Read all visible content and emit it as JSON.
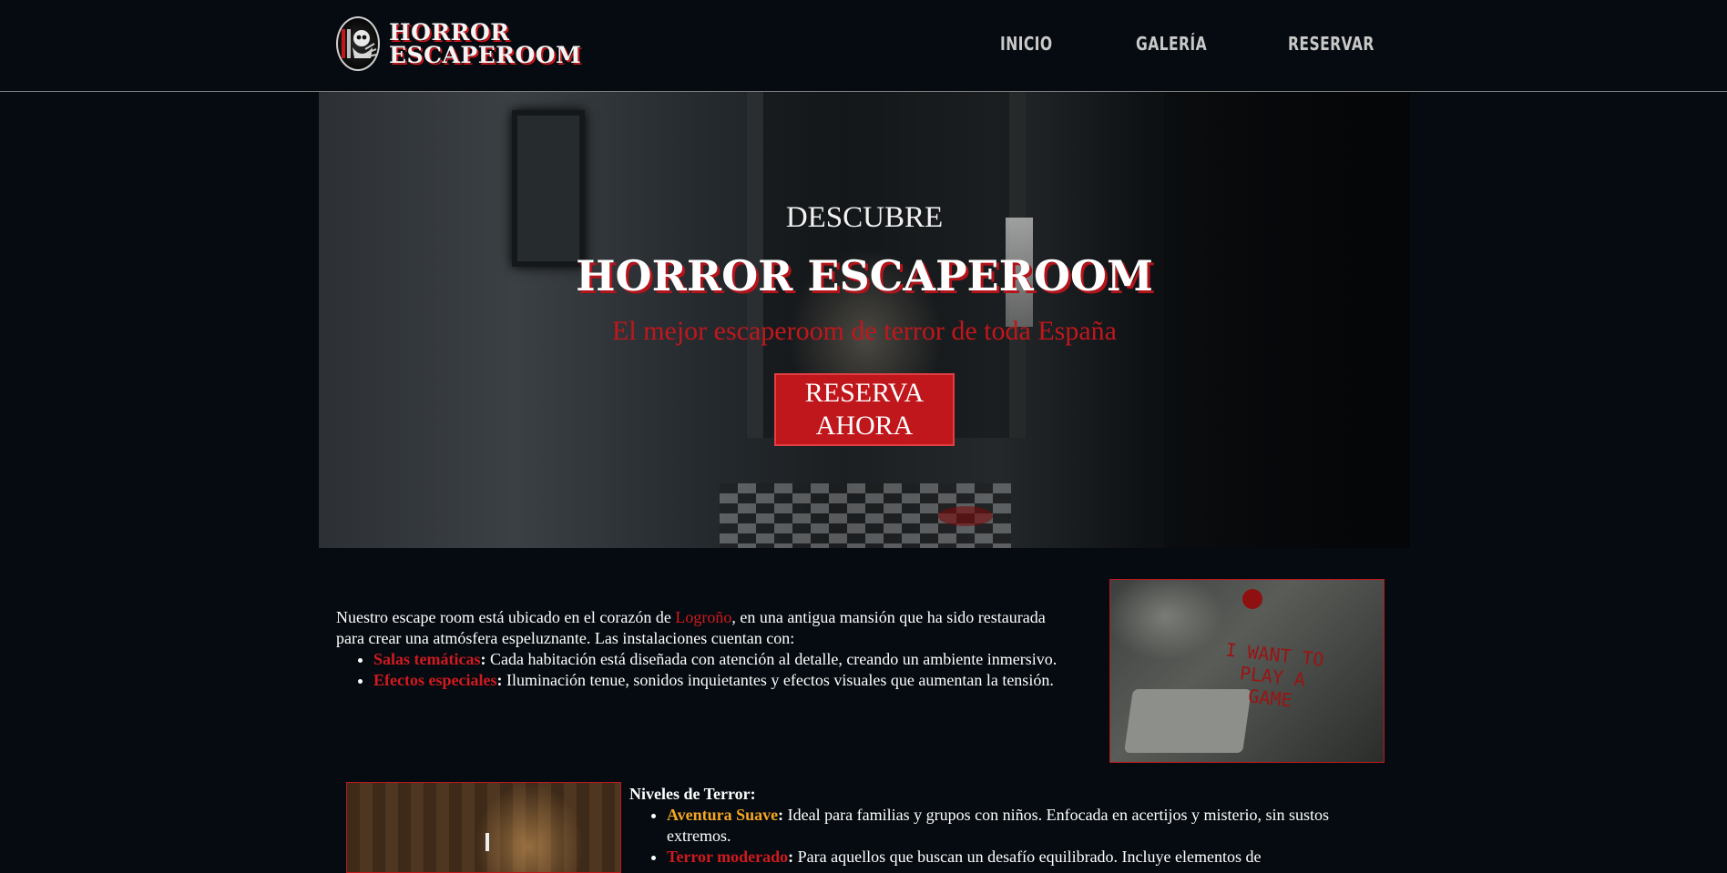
{
  "header": {
    "logo_line1": "HORROR",
    "logo_line2": "ESCAPEROOM",
    "nav": [
      "INICIO",
      "GALERÍA",
      "RESERVAR"
    ]
  },
  "hero": {
    "kicker": "DESCUBRE",
    "title": "HORROR ESCAPEROOM",
    "subtitle": "El mejor escaperoom de terror de toda España",
    "cta": "RESERVA AHORA"
  },
  "intro": {
    "text_before": "Nuestro escape room está ubicado en el corazón de ",
    "city": "Logroño",
    "text_after": ", en una antigua mansión que ha sido restaurada para crear una atmósfera espeluznante. Las instalaciones cuentan con:",
    "items": [
      {
        "term": "Salas temáticas",
        "desc": "Cada habitación está diseñada con atención al detalle, creando un ambiente inmersivo."
      },
      {
        "term": "Efectos especiales",
        "desc": "Iluminación tenue, sonidos inquietantes y efectos visuales que aumentan la tensión."
      }
    ],
    "image_text": "I WANT TO PLAY A GAME"
  },
  "levels": {
    "heading": "Niveles de Terror:",
    "items": [
      {
        "term": "Aventura Suave",
        "desc": "Ideal para familias y grupos con niños. Enfocada en acertijos y misterio, sin sustos extremos."
      },
      {
        "term": "Terror moderado",
        "desc": "Para aquellos que buscan un desafío equilibrado. Incluye elementos de"
      }
    ]
  },
  "colors": {
    "background": "#050b10",
    "accent_red": "#c0171c",
    "accent_orange": "#f5a623",
    "nav_text": "#c9c9c9"
  }
}
